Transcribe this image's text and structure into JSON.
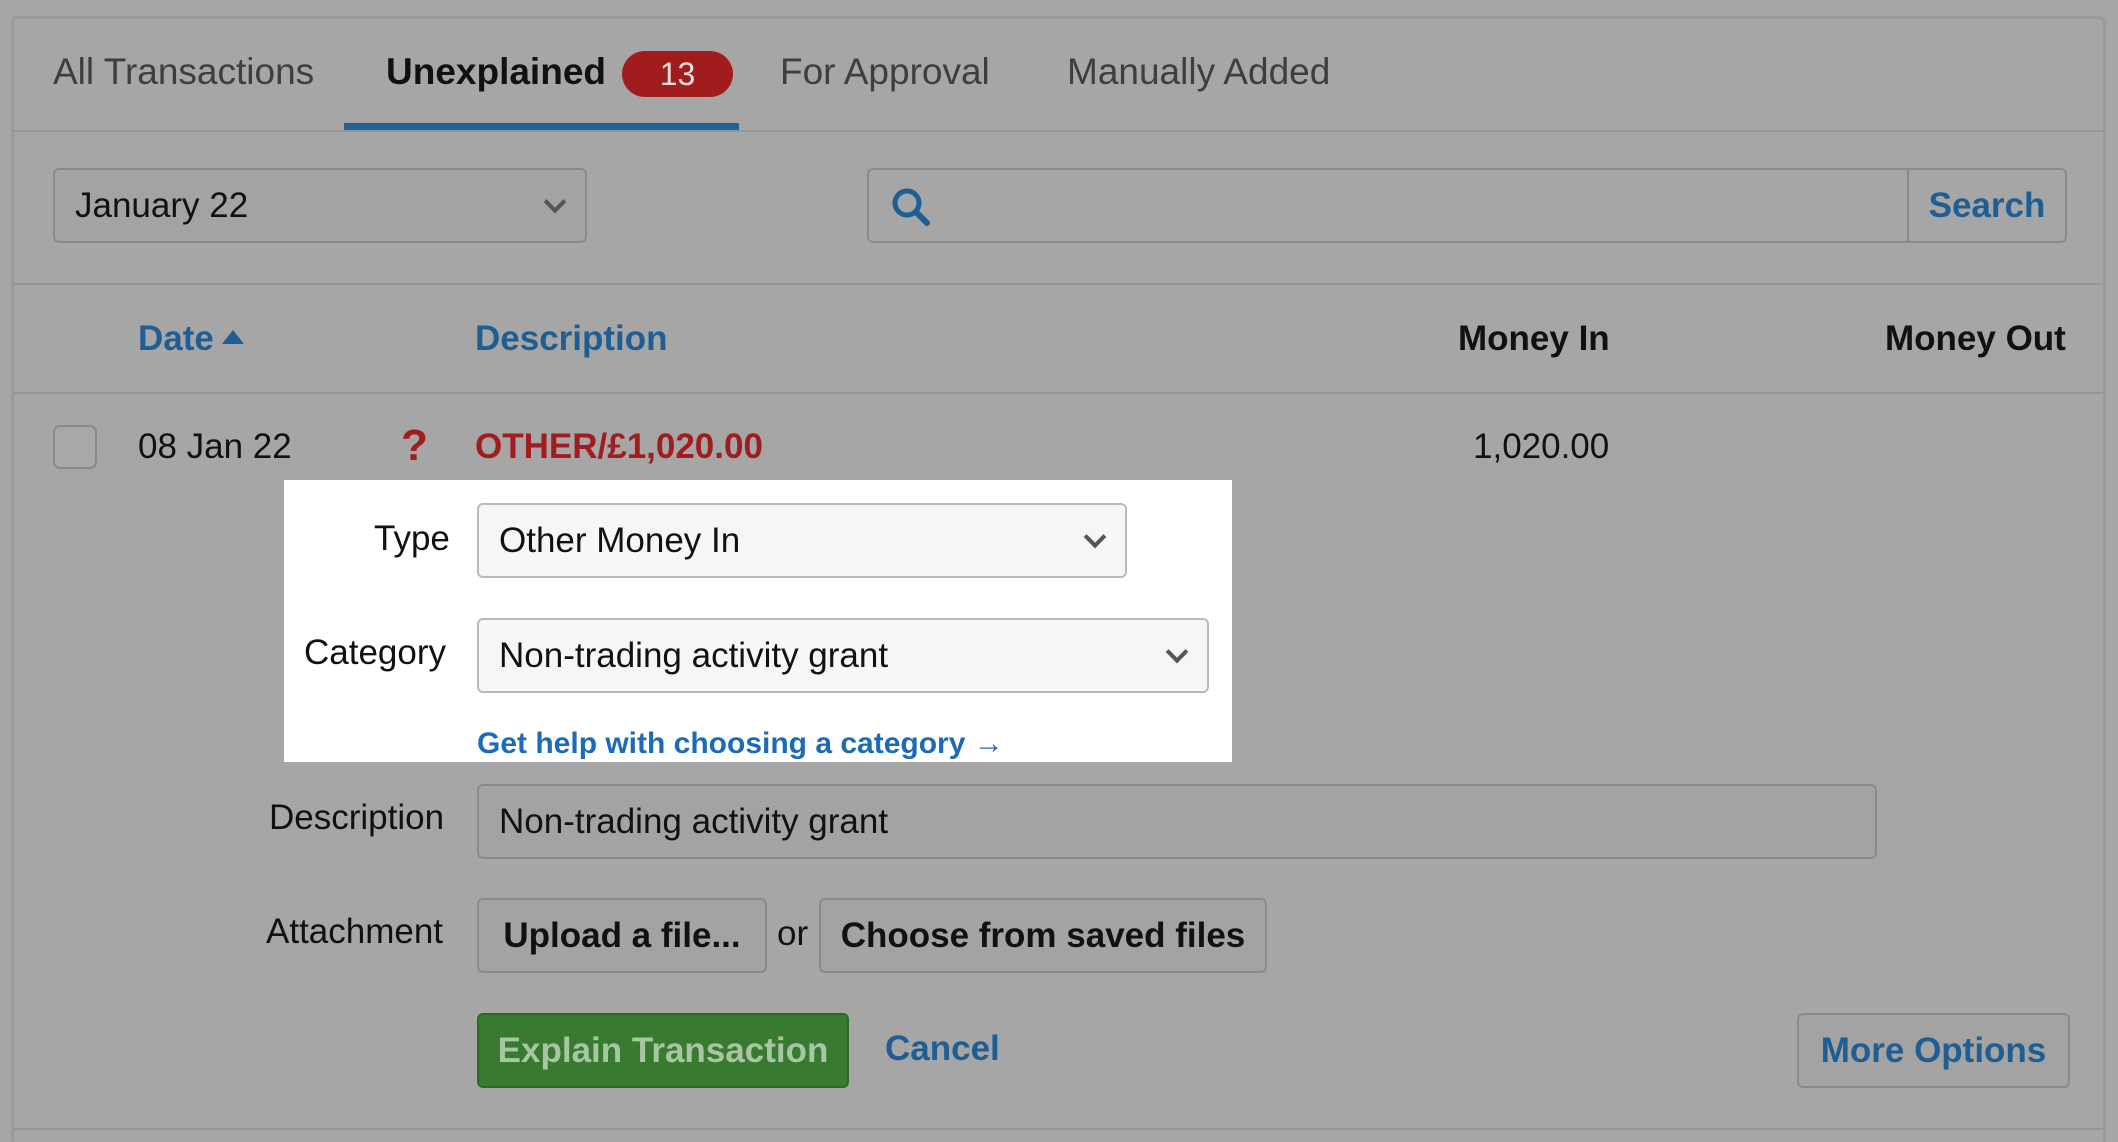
{
  "tabs": [
    {
      "label": "All Transactions"
    },
    {
      "label": "Unexplained",
      "badge": "13"
    },
    {
      "label": "For Approval"
    },
    {
      "label": "Manually Added"
    }
  ],
  "filters": {
    "month_value": "January 22",
    "search_value": "",
    "search_button": "Search"
  },
  "table": {
    "headers": {
      "date": "Date",
      "description": "Description",
      "money_in": "Money In",
      "money_out": "Money Out"
    },
    "row": {
      "date": "08 Jan 22",
      "status_mark": "?",
      "description": "OTHER/£1,020.00",
      "money_in": "1,020.00",
      "money_out": ""
    }
  },
  "form": {
    "type_label": "Type",
    "type_value": "Other Money In",
    "category_label": "Category",
    "category_value": "Non-trading activity grant",
    "help_link": "Get help with choosing a category →",
    "description_label": "Description",
    "description_value": "Non-trading activity grant",
    "attachment_label": "Attachment",
    "upload_button": "Upload a file...",
    "or_text": "or",
    "choose_saved_button": "Choose from saved files",
    "explain_button": "Explain Transaction",
    "cancel_link": "Cancel",
    "more_options_button": "More Options"
  },
  "colors": {
    "accent_blue": "#1e5e93",
    "link_blue": "#1b6bb8",
    "alert_red": "#a11c1c",
    "green_button": "#397a31"
  }
}
